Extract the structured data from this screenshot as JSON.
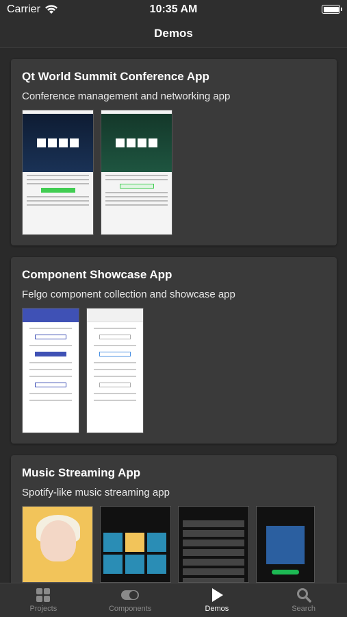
{
  "status_bar": {
    "carrier": "Carrier",
    "time": "10:35 AM"
  },
  "nav": {
    "title": "Demos"
  },
  "cards": [
    {
      "title": "Qt World Summit Conference App",
      "subtitle": "Conference management and networking app"
    },
    {
      "title": "Component Showcase App",
      "subtitle": "Felgo component collection and showcase app"
    },
    {
      "title": "Music Streaming App",
      "subtitle": "Spotify-like music streaming app"
    }
  ],
  "tabs": [
    {
      "label": "Projects",
      "icon": "grid-icon"
    },
    {
      "label": "Components",
      "icon": "toggle-icon"
    },
    {
      "label": "Demos",
      "icon": "play-icon"
    },
    {
      "label": "Search",
      "icon": "search-icon"
    }
  ],
  "active_tab": "Demos",
  "colors": {
    "background": "#2e2e2e",
    "card": "#3a3a3a",
    "accent_green": "#41cd52",
    "accent_indigo": "#3f51b5"
  }
}
